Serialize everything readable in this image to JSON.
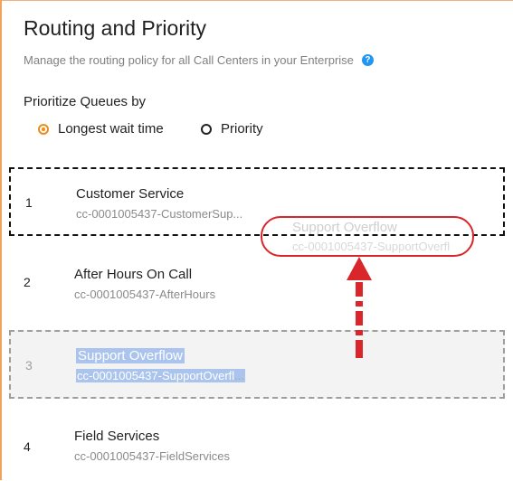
{
  "page": {
    "title": "Routing and Priority",
    "subtitle": "Manage the routing policy for all Call Centers in your Enterprise",
    "help_icon_glyph": "?"
  },
  "prioritize": {
    "label": "Prioritize Queues by",
    "options": [
      {
        "label": "Longest wait time",
        "selected": true
      },
      {
        "label": "Priority",
        "selected": false
      }
    ]
  },
  "queues": [
    {
      "number": "1",
      "name": "Customer Service",
      "id": "cc-0001005437-CustomerSup..."
    },
    {
      "number": "2",
      "name": "After Hours On Call",
      "id": "cc-0001005437-AfterHours"
    },
    {
      "number": "3",
      "name": "Support Overflow",
      "id": "cc-0001005437-SupportOverfl",
      "id_ellipsis": "..."
    },
    {
      "number": "4",
      "name": "Field Services",
      "id": "cc-0001005437-FieldServices"
    }
  ],
  "drag_ghost": {
    "name": "Support Overflow",
    "id": "cc-0001005437-SupportOverfl"
  },
  "colors": {
    "accent": "#f08a1a",
    "help": "#2196f3",
    "annotation": "#d9262a",
    "selection": "#aac4ee"
  },
  "icons": {
    "help": "question-circle-icon",
    "drag_arrow": "arrow-up-annotation"
  }
}
